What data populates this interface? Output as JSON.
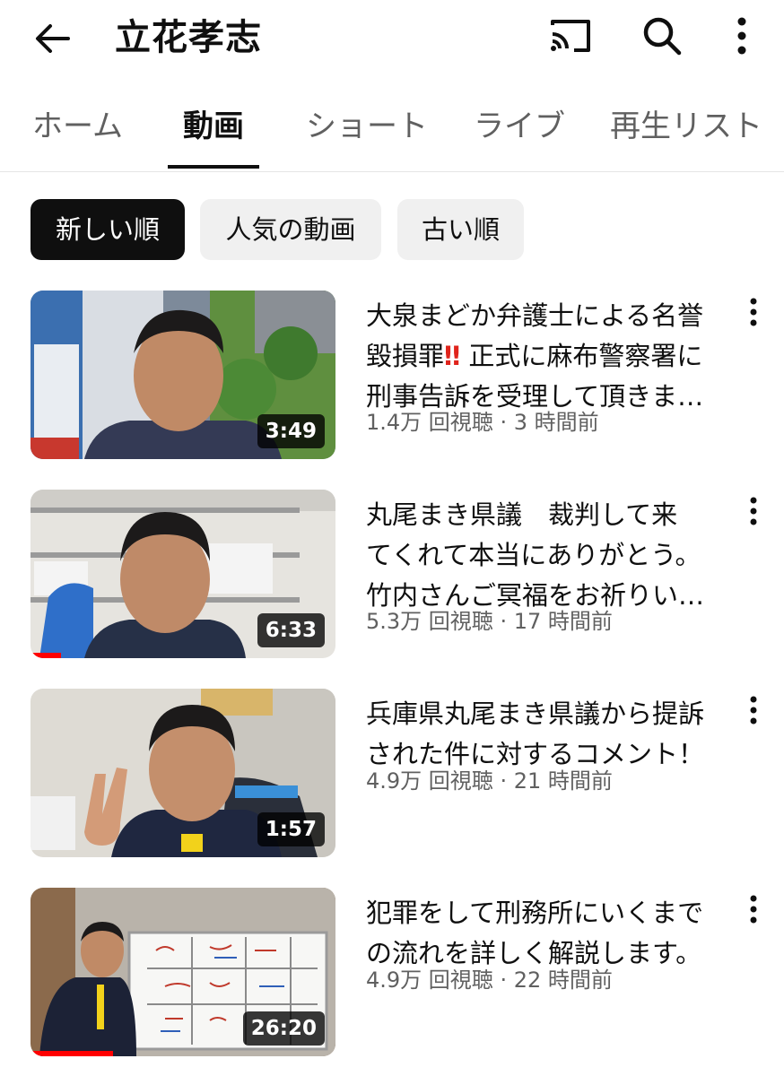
{
  "header": {
    "title": "立花孝志",
    "icons": [
      "back-arrow-icon",
      "cast-icon",
      "search-icon",
      "more-vert-icon"
    ]
  },
  "tabs": [
    {
      "label": "ホーム",
      "active": false
    },
    {
      "label": "動画",
      "active": true
    },
    {
      "label": "ショート",
      "active": false
    },
    {
      "label": "ライブ",
      "active": false
    },
    {
      "label": "再生リスト",
      "active": false
    }
  ],
  "chips": [
    {
      "label": "新しい順",
      "selected": true
    },
    {
      "label": "人気の動画",
      "selected": false
    },
    {
      "label": "古い順",
      "selected": false
    }
  ],
  "videos": [
    {
      "title_lines": [
        "大泉まどか弁護士による名誉",
        "毀損罪",
        "正式に麻布警察署に",
        "刑事告訴を受理して頂きま…"
      ],
      "emphasis": "‼",
      "views": "1.4万 回視聴",
      "age": "3 時間前",
      "duration": "3:49",
      "watched_fraction": 0
    },
    {
      "title_lines": [
        "丸尾まき県議　裁判して来",
        "てくれて本当にありがとう。",
        "竹内さんご冥福をお祈りい…"
      ],
      "views": "5.3万 回視聴",
      "age": "17 時間前",
      "duration": "6:33",
      "watched_fraction": 0.1
    },
    {
      "title_lines": [
        "兵庫県丸尾まき県議から提訴",
        "された件に対するコメント！"
      ],
      "views": "4.9万 回視聴",
      "age": "21 時間前",
      "duration": "1:57",
      "watched_fraction": 0
    },
    {
      "title_lines": [
        "犯罪をして刑務所にいくまで",
        "の流れを詳しく解説します。"
      ],
      "views": "4.9万 回視聴",
      "age": "22 時間前",
      "duration": "26:20",
      "watched_fraction": 0.27
    }
  ],
  "meta_separator": "·",
  "colors": {
    "accent": "#ff0000",
    "text": "#0f0f0f",
    "secondary": "#606060",
    "chip_bg": "#f0f0f0"
  }
}
